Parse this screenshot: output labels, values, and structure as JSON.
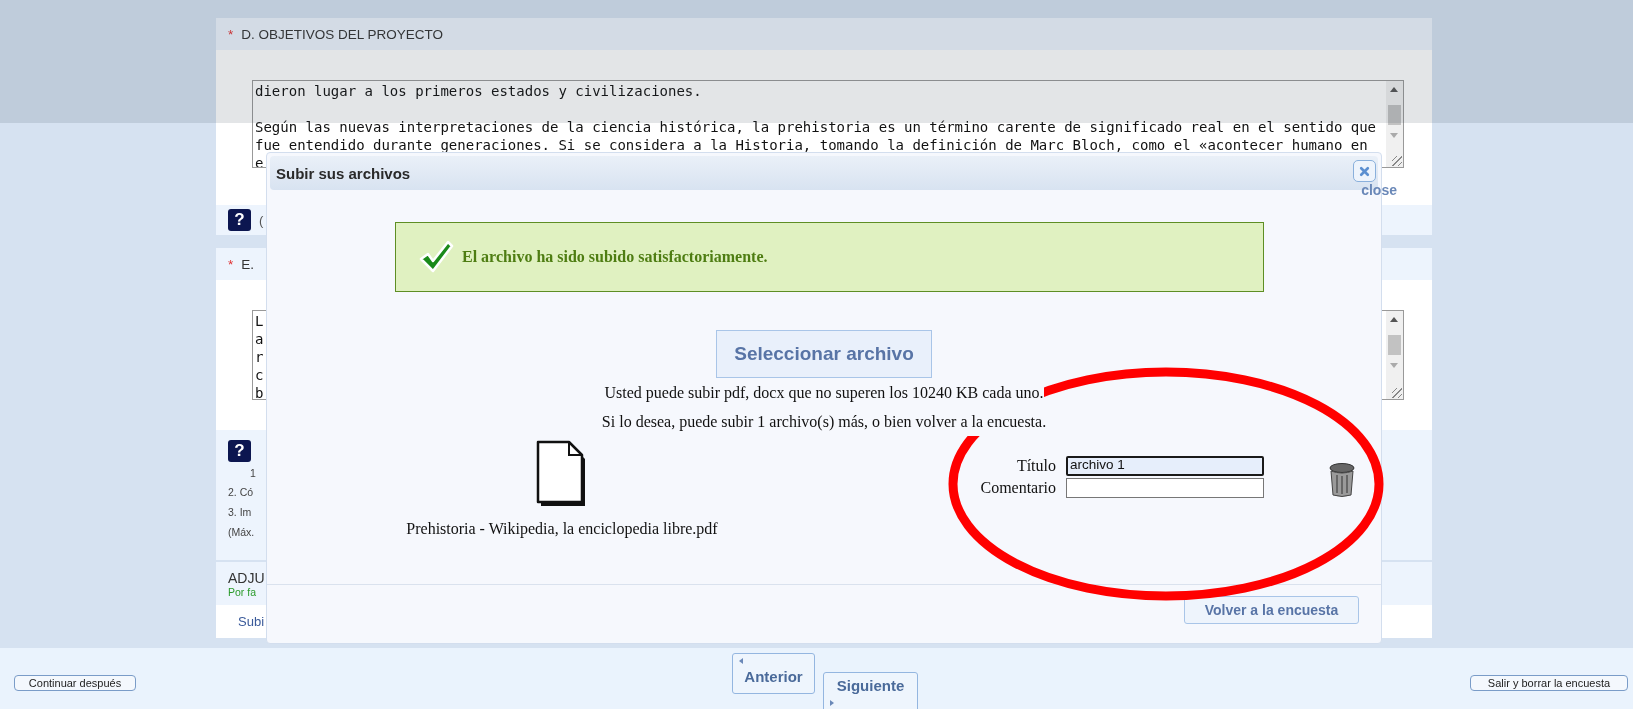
{
  "section_d": {
    "required_mark": "*",
    "title": "D. OBJETIVOS DEL PROYECTO",
    "answer": "dieron lugar a los primeros estados y civilizaciones.\n\nSegún las nuevas interpretaciones de la ciencia histórica, la prehistoria es un término carente de significado real en el sentido que\nfue entendido durante generaciones. Si se considera a la Historia, tomando la definición de Marc Bloch, como el «acontecer humano en\ne",
    "help_icon": "?",
    "help_text": "("
  },
  "section_e": {
    "required_mark": "*",
    "title": "E.",
    "answer": "L\na\nr\nc\nb",
    "help_icon": "?",
    "help_lines": [
      "1",
      "2. Có",
      "3. Im",
      "(Máx."
    ]
  },
  "attachments": {
    "title": "ADJU",
    "note": "Por fa",
    "link": "Subi"
  },
  "dialog": {
    "title": "Subir sus archivos",
    "close_label": "close",
    "message": "El archivo ha sido subido satisfactoriamente.",
    "select_button": "Seleccionar archivo",
    "info_lines": [
      "Usted puede subir pdf, docx que no superen los 10240 KB cada uno.",
      "Si lo desea, puede subir 1 archivo(s) más, o bien volver a la encuesta."
    ],
    "files": [
      {
        "name": "Prehistoria - Wikipedia, la enciclopedia libre.pdf",
        "title_label": "Título",
        "title_value": "archivo 1",
        "title_focused": true,
        "comment_label": "Comentario"
      }
    ],
    "back_button": "Volver a la encuesta"
  },
  "nav": {
    "continue_later": "Continuar después",
    "previous": "Anterior",
    "next": "Siguiente",
    "exit": "Salir y borrar la encuesta"
  }
}
